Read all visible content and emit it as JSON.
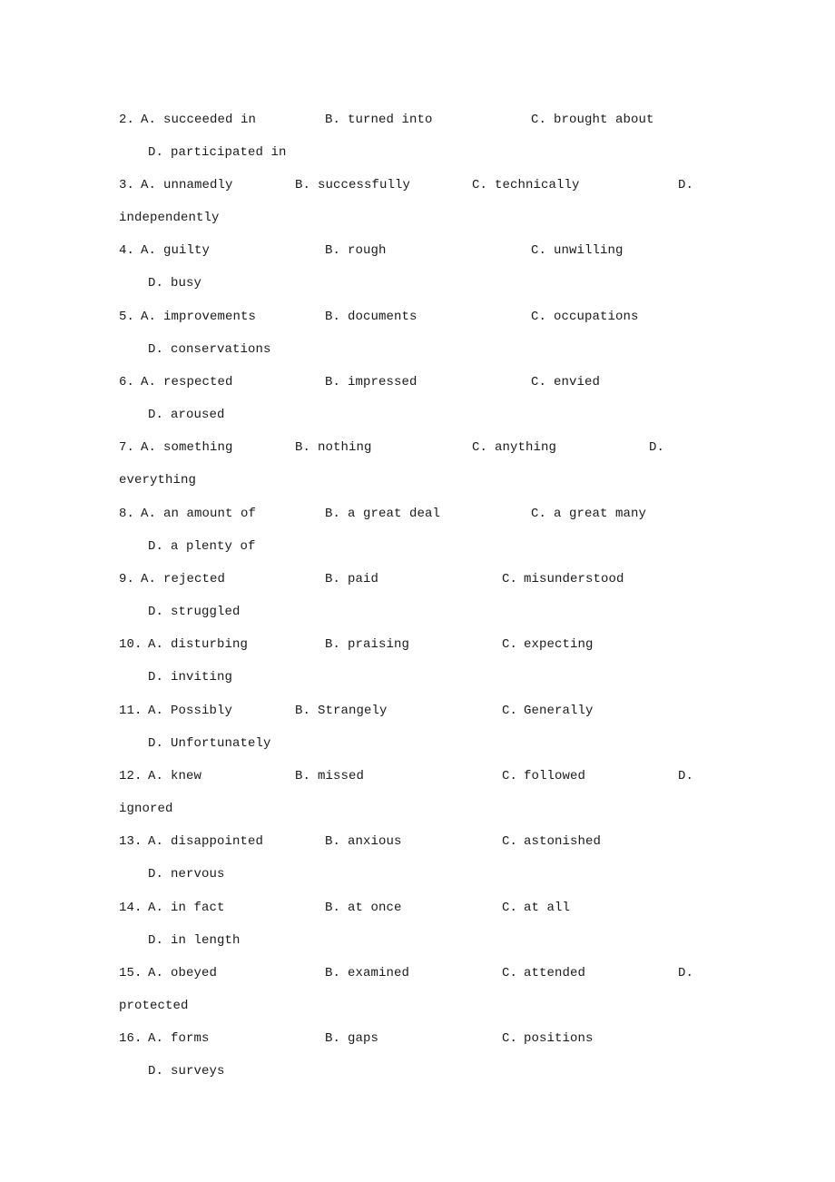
{
  "questions": [
    {
      "num": "2.",
      "A": "succeeded in",
      "B": "turned into",
      "C": "brought about",
      "D": "participated in"
    },
    {
      "num": "3.",
      "A": "unnamedly",
      "B": "successfully",
      "C": "technically",
      "D": "independently"
    },
    {
      "num": "4.",
      "A": "guilty",
      "B": "rough",
      "C": "unwilling",
      "D": "busy"
    },
    {
      "num": "5.",
      "A": "improvements",
      "B": "documents",
      "C": "occupations",
      "D": "conservations"
    },
    {
      "num": "6.",
      "A": "respected",
      "B": "impressed",
      "C": "envied",
      "D": "aroused"
    },
    {
      "num": "7.",
      "A": "something",
      "B": "nothing",
      "C": "anything",
      "D": "everything"
    },
    {
      "num": "8.",
      "A": "an amount of",
      "B": "a great deal",
      "C": "a great many",
      "D": "a plenty of"
    },
    {
      "num": "9.",
      "A": "rejected",
      "B": "paid",
      "C": "misunderstood",
      "D": "struggled"
    },
    {
      "num": "10.",
      "A": "disturbing",
      "B": "praising",
      "C": "expecting",
      "D": "inviting"
    },
    {
      "num": "11.",
      "A": "Possibly",
      "B": "Strangely",
      "C": "Generally",
      "D": "Unfortunately"
    },
    {
      "num": "12.",
      "A": "knew",
      "B": "missed",
      "C": "followed",
      "D": "ignored"
    },
    {
      "num": "13.",
      "A": "disappointed",
      "B": "anxious",
      "C": "astonished",
      "D": "nervous"
    },
    {
      "num": "14.",
      "A": "in fact",
      "B": "at once",
      "C": "at all",
      "D": "in length"
    },
    {
      "num": "15.",
      "A": "obeyed",
      "B": "examined",
      "C": "attended",
      "D": "protected"
    },
    {
      "num": "16.",
      "A": "forms",
      "B": "gaps",
      "C": "positions",
      "D": "surveys"
    }
  ],
  "letters": {
    "A": "A.",
    "B": "B.",
    "C": "C.",
    "D": "D."
  }
}
